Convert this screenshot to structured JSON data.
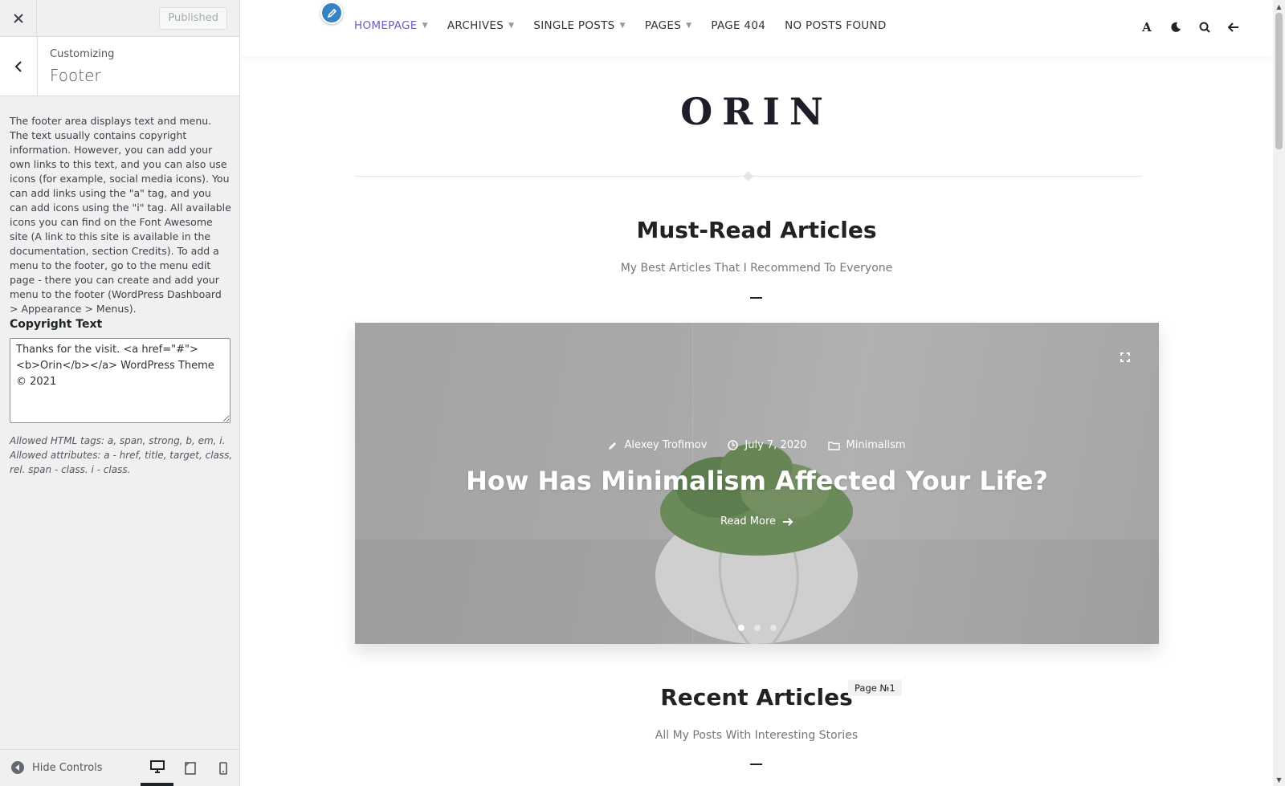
{
  "sidebar": {
    "published_label": "Published",
    "customizing_label": "Customizing",
    "section_title": "Footer",
    "description": "The footer area displays text and menu. The text usually contains copyright information. However, you can add your own links to this text, and you can also use icons (for example, social media icons). You can add links using the \"a\" tag, and you can add icons using the \"i\" tag. All available icons you can find on the Font Awesome site (A link to this site is available in the documentation, section Credits). To add a menu to the footer, go to the menu edit page - there you can create and add your menu to the footer (WordPress Dashboard > Appearance > Menus).",
    "copyright_label": "Copyright Text",
    "copyright_value": "Thanks for the visit. <a href=\"#\"><b>Orin</b></a> WordPress Theme © 2021",
    "allowed_note": "Allowed HTML tags: a, span, strong, b, em, i. Allowed attributes: a - href, title, target, class, rel. span - class. i - class.",
    "hide_controls_label": "Hide Controls"
  },
  "preview": {
    "nav": [
      {
        "label": "HOMEPAGE",
        "active": true,
        "dropdown": true
      },
      {
        "label": "ARCHIVES",
        "active": false,
        "dropdown": true
      },
      {
        "label": "SINGLE POSTS",
        "active": false,
        "dropdown": true
      },
      {
        "label": "PAGES",
        "active": false,
        "dropdown": true
      },
      {
        "label": "PAGE 404",
        "active": false,
        "dropdown": false
      },
      {
        "label": "NO POSTS FOUND",
        "active": false,
        "dropdown": false
      }
    ],
    "logo": "ORIN",
    "must_read_title": "Must-Read Articles",
    "must_read_subtitle": "My Best Articles That I Recommend To Everyone",
    "slide": {
      "author": "Alexey Trofimov",
      "date": "July 7, 2020",
      "category": "Minimalism",
      "title": "How Has Minimalism Affected Your Life?",
      "read_more": "Read More"
    },
    "recent_title": "Recent Articles",
    "page_badge": "Page №1",
    "recent_subtitle": "All My Posts With Interesting Stories"
  },
  "colors": {
    "accent": "#6a5fc1",
    "edit_shortcut": "#3582c4"
  }
}
